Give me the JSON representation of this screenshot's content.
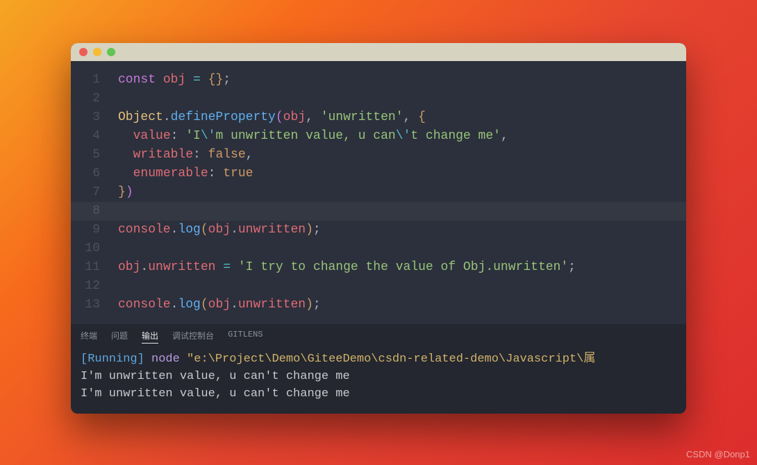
{
  "titlebar": {
    "buttons": [
      "close",
      "minimize",
      "zoom"
    ]
  },
  "code": {
    "line_numbers": [
      "1",
      "2",
      "3",
      "4",
      "5",
      "6",
      "7",
      "8",
      "9",
      "10",
      "11",
      "12",
      "13"
    ],
    "l1": {
      "kw": "const",
      "sp": " ",
      "var": "obj",
      "sp2": " ",
      "op": "=",
      "sp3": " ",
      "b1o": "{",
      "b1c": "}",
      "semi": ";"
    },
    "l3": {
      "cls": "Object",
      "dot": ".",
      "fn": "defineProperty",
      "p2o": "(",
      "var": "obj",
      "com": ", ",
      "str": "'unwritten'",
      "com2": ", ",
      "b1o": "{"
    },
    "l4": {
      "ind": "  ",
      "prop": "value",
      "colon": ": ",
      "q1": "'",
      "s1": "I",
      "esc1": "\\'",
      "s2": "m unwritten value, u can",
      "esc2": "\\'",
      "s3": "t change me",
      "q2": "'",
      "com": ","
    },
    "l5": {
      "ind": "  ",
      "prop": "writable",
      "colon": ": ",
      "bool": "false",
      "com": ","
    },
    "l6": {
      "ind": "  ",
      "prop": "enumerable",
      "colon": ": ",
      "bool": "true"
    },
    "l7": {
      "b1c": "}",
      "p2c": ")"
    },
    "l9": {
      "var": "console",
      "dot": ".",
      "fn": "log",
      "p1o": "(",
      "obj": "obj",
      "dot2": ".",
      "prop": "unwritten",
      "p1c": ")",
      "semi": ";"
    },
    "l11": {
      "obj": "obj",
      "dot": ".",
      "prop": "unwritten",
      "sp": " ",
      "op": "=",
      "sp2": " ",
      "str": "'I try to change the value of Obj.unwritten'",
      "semi": ";"
    },
    "l13": {
      "var": "console",
      "dot": ".",
      "fn": "log",
      "p1o": "(",
      "obj": "obj",
      "dot2": ".",
      "prop": "unwritten",
      "p1c": ")",
      "semi": ";"
    }
  },
  "panel": {
    "tabs": {
      "terminal": "终端",
      "problems": "问题",
      "output": "输出",
      "debug": "调试控制台",
      "gitlens": "GITLENS"
    },
    "active_tab": "output"
  },
  "terminal": {
    "tag_open": "[",
    "tag": "Running",
    "tag_close": "]",
    "cmd": " node ",
    "quote": "\"",
    "path": "e:\\Project\\Demo\\GiteeDemo\\csdn-related-demo\\Javascript\\属",
    "out1": "I'm unwritten value, u can't change me",
    "out2": "I'm unwritten value, u can't change me"
  },
  "watermark": "CSDN @Donp1"
}
